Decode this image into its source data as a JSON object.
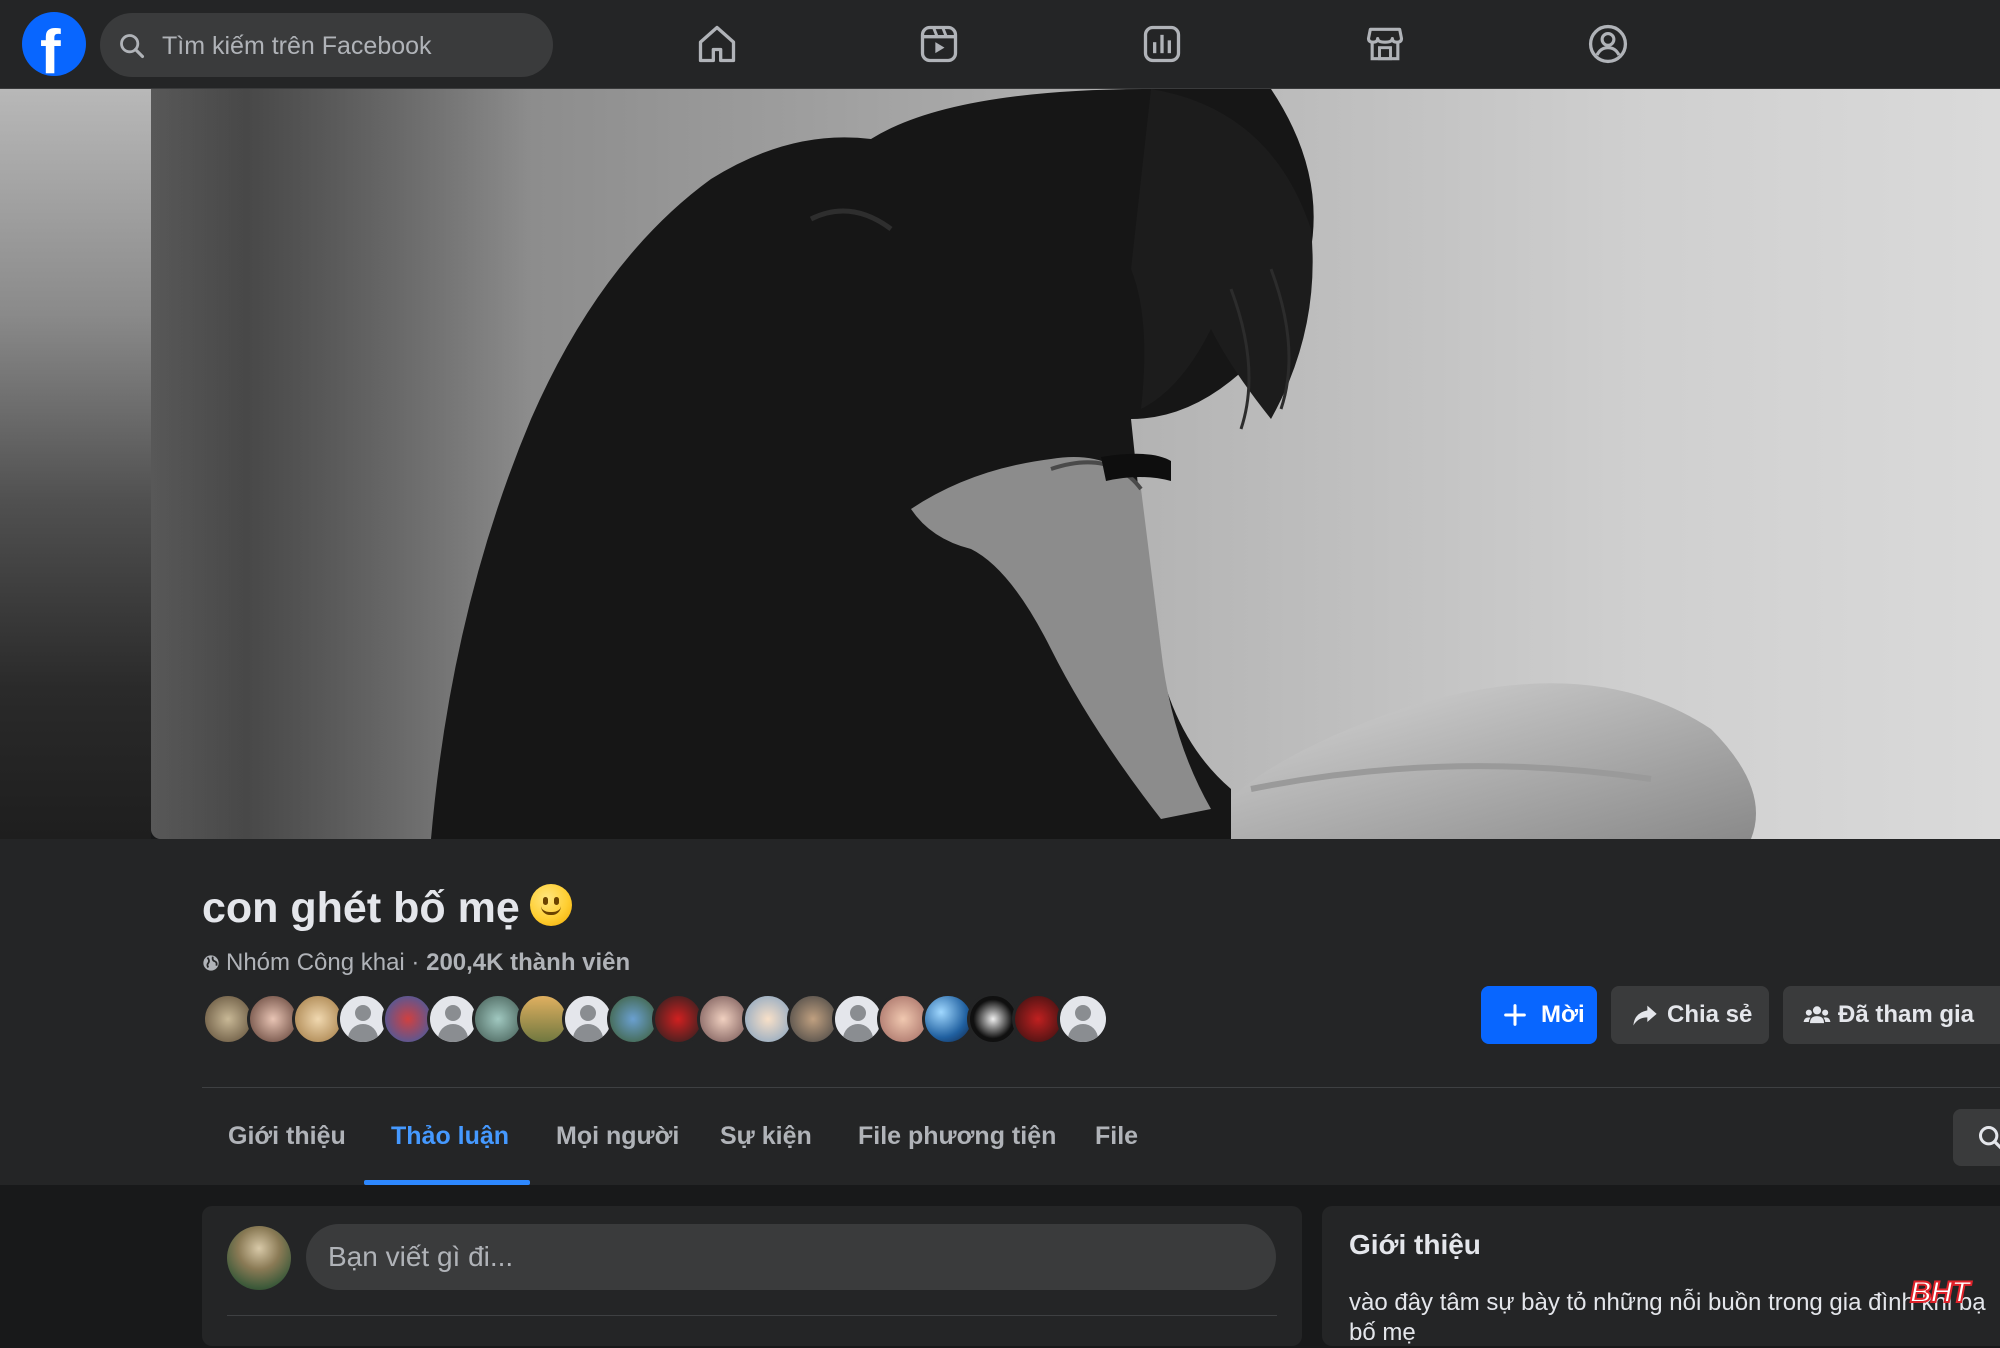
{
  "search": {
    "placeholder": "Tìm kiếm trên Facebook"
  },
  "nav": [
    "home-icon",
    "video-icon",
    "groups-feed-icon",
    "marketplace-icon",
    "people-icon"
  ],
  "group": {
    "name": "con ghét bố mẹ",
    "privacy": "Nhóm Công khai",
    "separator": " · ",
    "members": "200,4K thành viên"
  },
  "actions": {
    "invite": "Mời",
    "share": "Chia sẻ",
    "joined": "Đã tham gia"
  },
  "tabs": [
    "Giới thiệu",
    "Thảo luận",
    "Mọi người",
    "Sự kiện",
    "File phương tiện",
    "File"
  ],
  "active_tab": "Thảo luận",
  "composer": {
    "placeholder": "Bạn viết gì đi..."
  },
  "about": {
    "title": "Giới thiệu",
    "description": "vào đây tâm sự bày tỏ những nỗi buồn trong gia đình khi bạ",
    "description_line2": "bố mẹ"
  },
  "watermark": "BHT"
}
